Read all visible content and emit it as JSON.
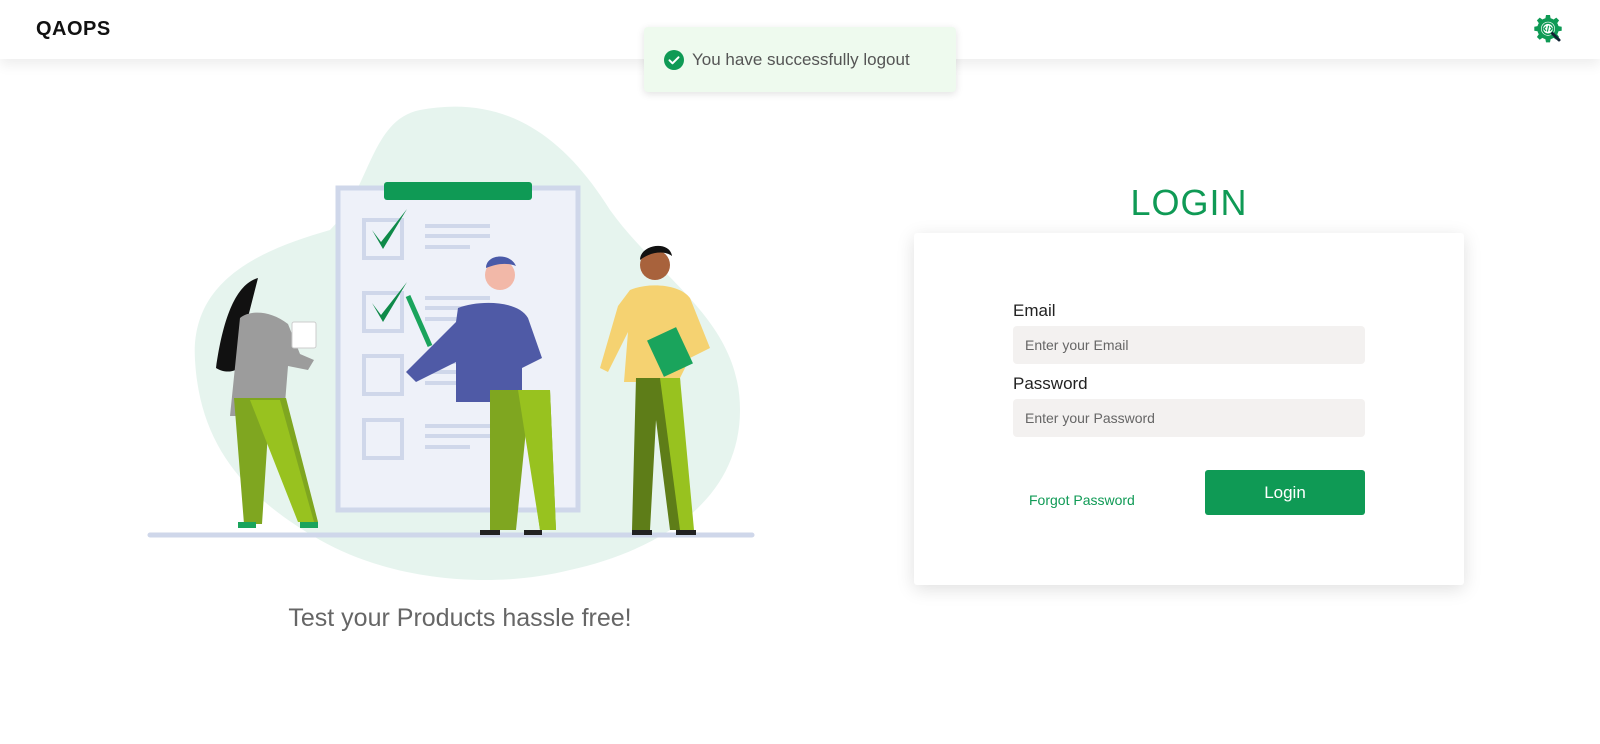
{
  "header": {
    "brand": "QAOPS",
    "settings_icon": "gear-code-search-icon"
  },
  "toast": {
    "message": "You have successfully logout",
    "icon": "check-circle-icon"
  },
  "hero": {
    "tagline": "Test your Products hassle free!",
    "illustration": "team-checklist-illustration"
  },
  "login": {
    "title": "LOGIN",
    "email_label": "Email",
    "email_placeholder": "Enter your Email",
    "password_label": "Password",
    "password_placeholder": "Enter your Password",
    "forgot_label": "Forgot Password",
    "submit_label": "Login"
  },
  "colors": {
    "brand_green": "#0f9a55",
    "toast_bg": "#eefaee",
    "input_bg": "#f3f1f0"
  }
}
